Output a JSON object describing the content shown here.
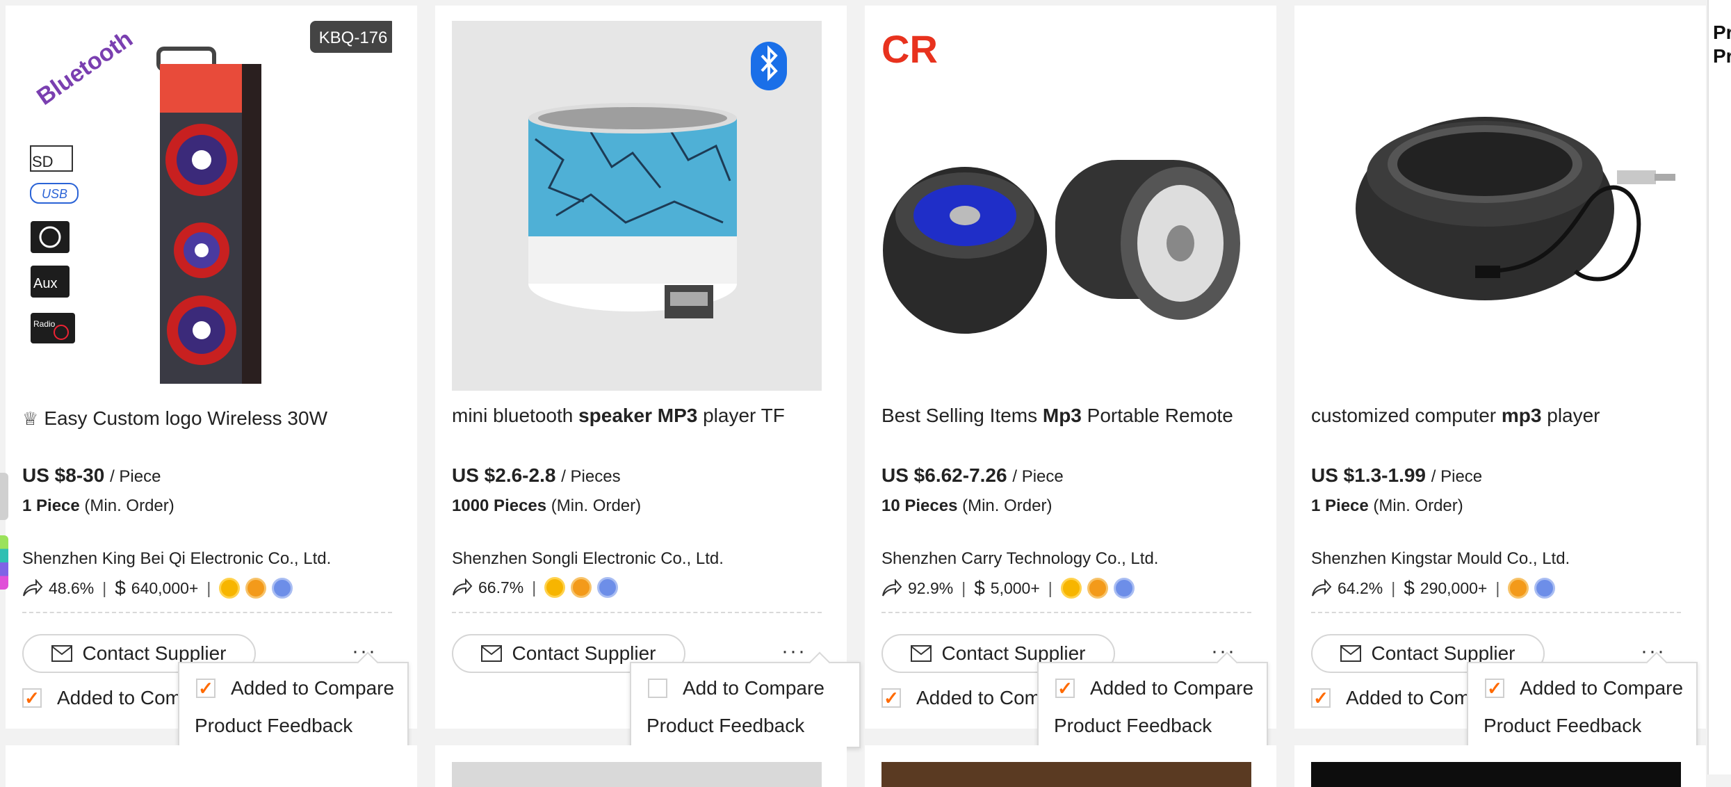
{
  "cards": [
    {
      "title_parts": [
        "Easy Custom logo Wireless 30W"
      ],
      "image_alt": "Trolley LED party speaker with light rings",
      "model_tag": "KBQ-176",
      "logo_text": "Bluetooth",
      "feature_labels": [
        "SD",
        "USB",
        "Aux",
        "Radio"
      ],
      "price": "US $8-30",
      "unit": "/ Piece",
      "min_qty": "1 Piece",
      "min_label": "(Min. Order)",
      "supplier": "Shenzhen King Bei Qi Electronic Co., Ltd.",
      "response": "48.6%",
      "revenue": "640,000+",
      "badges": [
        "gold",
        "orange",
        "blue"
      ],
      "contact": "Contact Supplier",
      "compare": "Added to Compare",
      "compare_checked": true,
      "popup_compare": "Added to Compare",
      "popup_checked": true,
      "feedback": "Product Feedback"
    },
    {
      "title_a": "mini bluetooth ",
      "title_b": "speaker MP3",
      "title_c": " player TF",
      "image_alt": "Blue crackle mini LED bluetooth speaker",
      "price": "US $2.6-2.8",
      "unit": "/ Pieces",
      "min_qty": "1000 Pieces",
      "min_label": "(Min. Order)",
      "supplier": "Shenzhen Songli Electronic Co., Ltd.",
      "response": "66.7%",
      "badges": [
        "gold",
        "orange",
        "blue"
      ],
      "contact": "Contact Supplier",
      "popup_compare": "Add to Compare",
      "popup_checked": false,
      "feedback": "Product Feedback"
    },
    {
      "title_a": "Best Selling Items ",
      "title_b": "Mp3",
      "title_c": " Portable Remote",
      "image_alt": "Tire shaped portable speakers",
      "brand_logo": "CR",
      "price": "US $6.62-7.26",
      "unit": "/ Piece",
      "min_qty": "10 Pieces",
      "min_label": "(Min. Order)",
      "supplier": "Shenzhen Carry Technology Co., Ltd.",
      "response": "92.9%",
      "revenue": "5,000+",
      "badges": [
        "gold",
        "orange",
        "blue"
      ],
      "contact": "Contact Supplier",
      "compare": "Added to Compare",
      "compare_checked": true,
      "popup_compare": "Added to Compare",
      "popup_checked": true,
      "feedback": "Product Feedback"
    },
    {
      "title_a": "customized computer ",
      "title_b": "mp3",
      "title_c": " player",
      "image_alt": "Black mini hamburger speaker with audio cable",
      "price": "US $1.3-1.99",
      "unit": "/ Piece",
      "min_qty": "1 Piece",
      "min_label": "(Min. Order)",
      "supplier": "Shenzhen Kingstar Mould Co., Ltd.",
      "response": "64.2%",
      "revenue": "290,000+",
      "badges": [
        "orange",
        "blue"
      ],
      "contact": "Contact Supplier",
      "compare": "Added to Compare",
      "compare_checked": true,
      "popup_compare": "Added to Compare",
      "popup_checked": true,
      "feedback": "Product Feedback"
    }
  ],
  "side_strip": {
    "line1": "Pr",
    "line2": "Pr"
  },
  "colors": {
    "accent": "#ff6a00",
    "bluetooth": "#1a6fe8",
    "brand_red": "#e8321e"
  }
}
